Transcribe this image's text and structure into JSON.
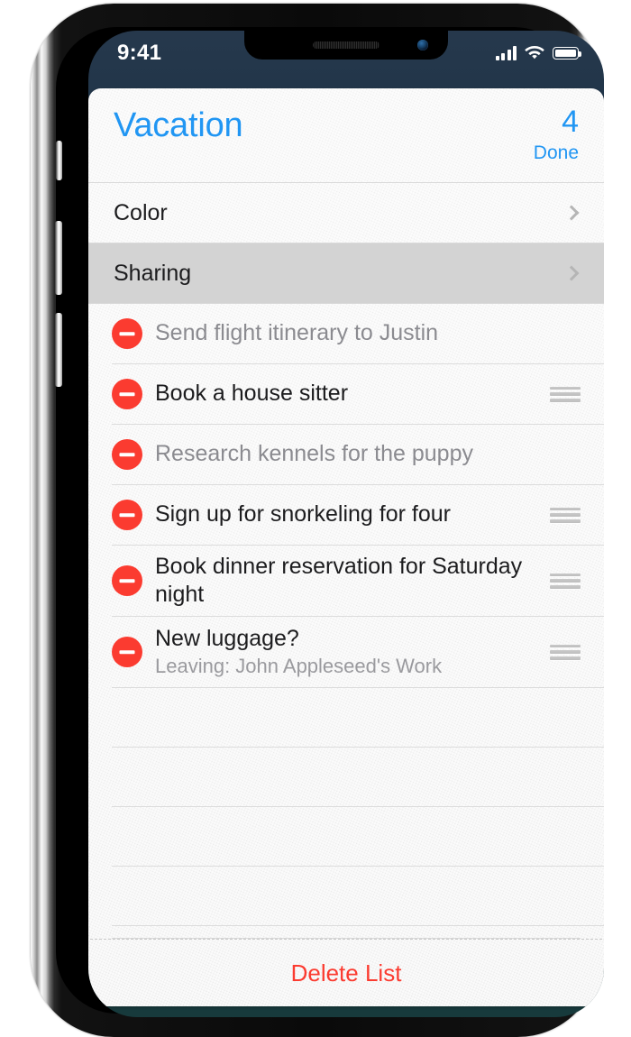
{
  "status_bar": {
    "time": "9:41",
    "signal_icon": "cellular-signal-icon",
    "wifi_icon": "wifi-icon",
    "battery_icon": "battery-icon"
  },
  "header": {
    "title": "Vacation",
    "count": "4",
    "done_label": "Done",
    "accent_color": "#2196f3"
  },
  "settings_rows": [
    {
      "label": "Color",
      "selected": false
    },
    {
      "label": "Sharing",
      "selected": true
    }
  ],
  "reminders": [
    {
      "title": "Send flight itinerary to Justin",
      "subtitle": "",
      "completed": true,
      "has_drag_handle": false,
      "two_line": false
    },
    {
      "title": "Book a house sitter",
      "subtitle": "",
      "completed": false,
      "has_drag_handle": true,
      "two_line": false
    },
    {
      "title": "Research kennels for the puppy",
      "subtitle": "",
      "completed": true,
      "has_drag_handle": false,
      "two_line": false
    },
    {
      "title": "Sign up for snorkeling for four",
      "subtitle": "",
      "completed": false,
      "has_drag_handle": true,
      "two_line": false
    },
    {
      "title": "Book dinner reservation for Saturday night",
      "subtitle": "",
      "completed": false,
      "has_drag_handle": true,
      "two_line": true
    },
    {
      "title": "New luggage?",
      "subtitle": "Leaving: John Appleseed's Work",
      "completed": false,
      "has_drag_handle": true,
      "two_line": true
    }
  ],
  "blank_line_count": 4,
  "footer": {
    "delete_list_label": "Delete List",
    "delete_color": "#fb3b30"
  },
  "device": {
    "mute_switch": "mute-switch",
    "volume_up": "volume-up-button",
    "volume_down": "volume-down-button",
    "power": "power-button"
  }
}
